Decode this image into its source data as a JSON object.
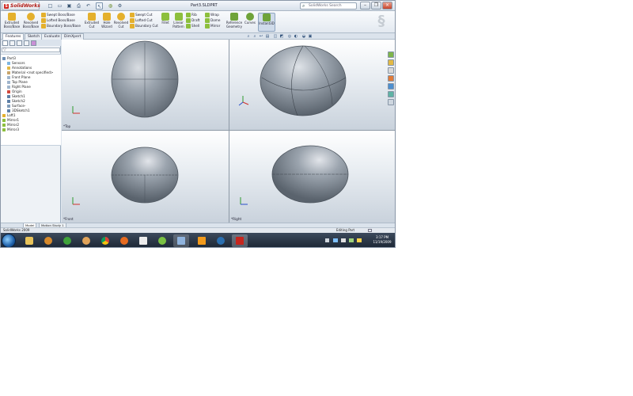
{
  "app": {
    "brand": "SolidWorks",
    "document_title": "Part3.SLDPRT",
    "search_placeholder": "SolidWorks Search"
  },
  "quick_access": [
    "new-icon",
    "open-icon",
    "save-icon",
    "print-icon",
    "undo-icon",
    "select-icon",
    "rebuild-icon",
    "options-icon"
  ],
  "window_controls": [
    "minimize",
    "restore",
    "close"
  ],
  "ribbon": {
    "big_buttons": [
      {
        "label": "Extruded Boss/Base",
        "color": "#e4b02d"
      },
      {
        "label": "Revolved Boss/Base",
        "color": "#e4b02d"
      },
      {
        "label": "Extruded Cut",
        "color": "#e4b02d"
      },
      {
        "label": "Hole Wizard",
        "color": "#e4b02d"
      },
      {
        "label": "Revolved Cut",
        "color": "#e4b02d"
      },
      {
        "label": "Fillet",
        "color": "#8dbf3d"
      },
      {
        "label": "Linear Pattern",
        "color": "#8dbf3d"
      },
      {
        "label": "Reference Geometry",
        "color": "#6fa33a"
      },
      {
        "label": "Curves",
        "color": "#6fa33a"
      },
      {
        "label": "Instant3D",
        "color": "#6fa33a"
      }
    ],
    "small_group_1": [
      "Swept Boss/Base",
      "Lofted Boss/Base",
      "Boundary Boss/Base"
    ],
    "small_group_2": [
      "Swept Cut",
      "Lofted Cut",
      "Boundary Cut"
    ],
    "small_group_3": [
      "Rib",
      "Draft",
      "Shell"
    ],
    "small_group_4": [
      "Wrap",
      "Dome",
      "Mirror"
    ]
  },
  "tabs": [
    "Features",
    "Sketch",
    "Evaluate",
    "DimXpert"
  ],
  "feature_tree": {
    "root": "Part3",
    "nodes": [
      "Sensors",
      "Annotations",
      "Material <not specified>",
      "Front Plane",
      "Top Plane",
      "Right Plane",
      "Origin",
      "Sketch1",
      "Sketch2",
      "Surface-",
      "3DSketch1",
      "Loft1",
      "Mirror1",
      "Mirror2",
      "Mirror3"
    ]
  },
  "viewports": [
    {
      "id": "top",
      "label": "*Top"
    },
    {
      "id": "iso",
      "label": ""
    },
    {
      "id": "front",
      "label": "*Front"
    },
    {
      "id": "right",
      "label": "*Right"
    }
  ],
  "bottom_tabs": [
    "Model",
    "Motion Study 1"
  ],
  "status": {
    "left": "SolidWorks 2009",
    "right": "Editing Part"
  },
  "taskbar": {
    "apps": [
      "explorer",
      "media-player",
      "chrome-like",
      "chrome",
      "firefox",
      "acrobat",
      "app-green",
      "window",
      "illustrator",
      "app-circle",
      "solidworks"
    ],
    "clock_time": "3:17 PM",
    "clock_date": "11/19/2009"
  }
}
